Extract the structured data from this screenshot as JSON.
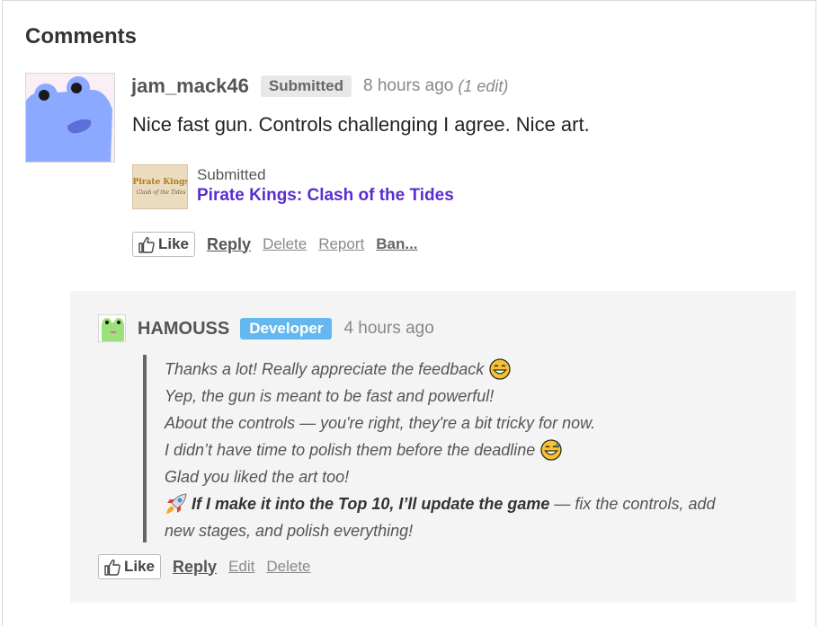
{
  "section": {
    "title": "Comments"
  },
  "comment1": {
    "username": "jam_mack46",
    "badge": "Submitted",
    "time": "8 hours ago",
    "edited": "(1 edit)",
    "body": "Nice fast gun. Controls challenging I agree. Nice art.",
    "submission": {
      "label": "Submitted",
      "game_title": "Pirate Kings: Clash of the Tides",
      "thumb_text": "Pirate Kings",
      "thumb_subtext": "Clash of the Tides"
    },
    "actions": {
      "like": "Like",
      "reply": "Reply",
      "delete": "Delete",
      "report": "Report",
      "ban": "Ban..."
    }
  },
  "reply": {
    "username": "HAMOUSS",
    "badge": "Developer",
    "time": "4 hours ago",
    "lines": {
      "l1": "Thanks a lot! Really appreciate the feedback",
      "l2": "Yep, the gun is meant to be fast and powerful!",
      "l3": "About the controls — you're right, they're a bit tricky for now.",
      "l4": "I didn’t have time to polish them before the deadline",
      "l5": "Glad you liked the art too!",
      "l6_bold": "If I make it into the Top 10, I’ll update the game",
      "l6_rest": " — fix the controls, add",
      "l7": "new stages, and polish everything!"
    },
    "actions": {
      "like": "Like",
      "reply": "Reply",
      "edit": "Edit",
      "delete": "Delete"
    }
  },
  "colors": {
    "link": "#5b2dd1",
    "developer_badge": "#65b8ef",
    "submitted_badge": "#e8e8e8",
    "reply_bg": "#f4f4f4"
  },
  "icons": {
    "like": "thumbs-up-icon",
    "grin": "grinning-face-emoji",
    "sweat": "grinning-sweat-emoji",
    "rocket": "rocket-emoji"
  }
}
